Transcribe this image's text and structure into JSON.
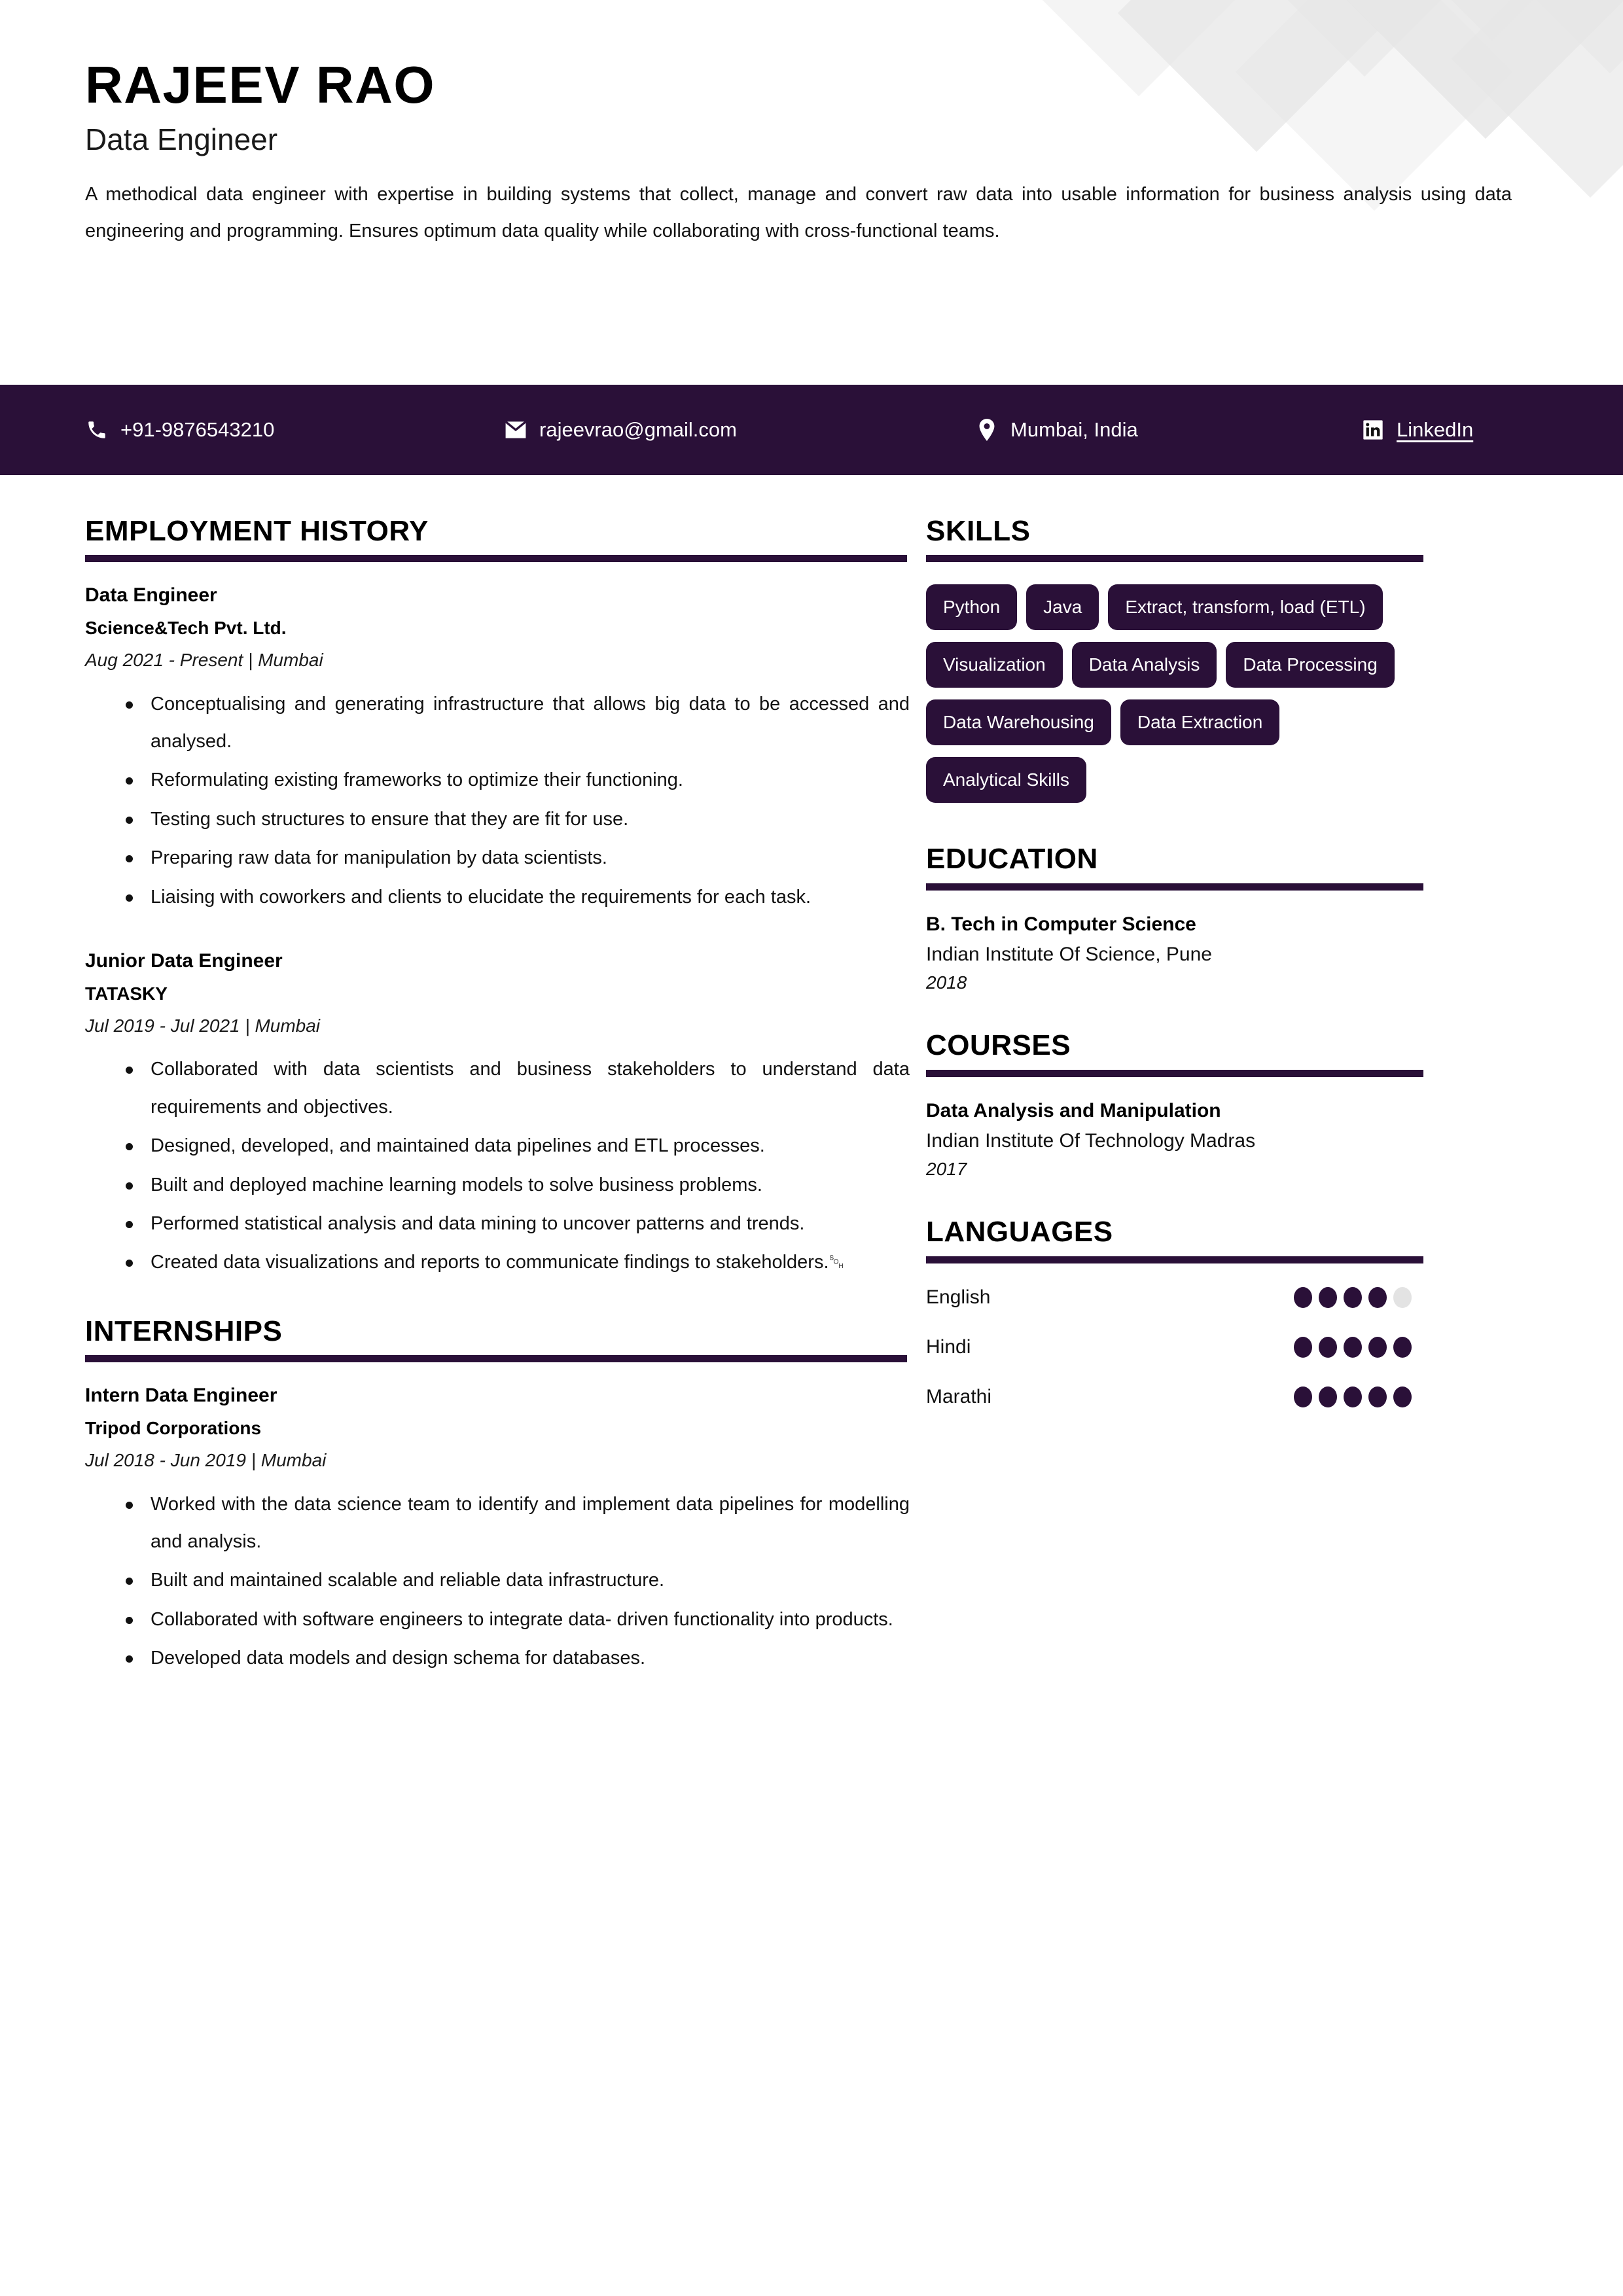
{
  "theme": {
    "accent": "#2a1038",
    "dot_filled": "#2a1038",
    "dot_empty": "#e3e3e3",
    "decoration": "#e6e6e6"
  },
  "header": {
    "name": "RAJEEV RAO",
    "role": "Data Engineer",
    "summary": "A methodical data engineer with expertise in building systems that collect, manage and convert raw data into usable information for business analysis using  data engineering and programming. Ensures optimum data quality while collaborating with cross-functional teams."
  },
  "contact": {
    "phone": {
      "icon": "phone-icon",
      "value": "+91-9876543210"
    },
    "email": {
      "icon": "envelope-icon",
      "value": "rajeevrao@gmail.com"
    },
    "location": {
      "icon": "map-pin-icon",
      "value": "Mumbai, India"
    },
    "linkedin": {
      "icon": "linkedin-icon",
      "value": "LinkedIn"
    }
  },
  "sections": {
    "employment_history": {
      "title": "EMPLOYMENT HISTORY",
      "jobs": [
        {
          "title": "Data Engineer",
          "company": "Science&Tech Pvt. Ltd.",
          "meta": "Aug 2021 - Present | Mumbai",
          "bullets": [
            "Conceptualising and generating infrastructure that allows big data to be accessed and analysed.",
            "Reformulating existing frameworks to optimize their functioning.",
            "Testing such structures to ensure that they are fit for use.",
            "Preparing raw data for manipulation by data scientists.",
            "Liaising with coworkers and clients to elucidate the requirements for each task."
          ]
        },
        {
          "title": "Junior Data Engineer",
          "company": "TATASKY",
          "meta": "Jul 2019 - Jul 2021 | Mumbai",
          "bullets": [
            "Collaborated with data scientists and business stakeholders to understand data requirements and objectives.",
            "Designed, developed, and maintained data pipelines and ETL processes.",
            "Built and deployed machine learning models to solve business problems.",
            "Performed statistical analysis and data mining to uncover patterns and trends.",
            "Created data visualizations and reports to communicate findings to stakeholders.␁"
          ]
        }
      ]
    },
    "internships": {
      "title": "INTERNSHIPS",
      "jobs": [
        {
          "title": "Intern Data Engineer",
          "company": "Tripod Corporations",
          "meta": "Jul 2018 - Jun 2019 | Mumbai",
          "bullets": [
            "Worked with the data science team to identify and implement data pipelines for modelling and analysis.",
            "Built and maintained scalable and reliable data infrastructure.",
            "Collaborated with software engineers to integrate data- driven functionality into products.",
            "Developed data models and design schema for databases."
          ]
        }
      ]
    },
    "skills": {
      "title": "SKILLS",
      "items": [
        "Python",
        "Java",
        "Extract, transform, load (ETL)",
        "Visualization",
        "Data Analysis",
        "Data Processing",
        "Data Warehousing",
        "Data Extraction",
        "Analytical Skills"
      ]
    },
    "education": {
      "title": "EDUCATION",
      "entries": [
        {
          "degree": "B. Tech in Computer Science",
          "institution": "Indian Institute Of Science, Pune",
          "year": "2018"
        }
      ]
    },
    "courses": {
      "title": "COURSES",
      "entries": [
        {
          "name": "Data Analysis and Manipulation",
          "institution": "Indian Institute Of Technology Madras",
          "year": "2017"
        }
      ]
    },
    "languages": {
      "title": "LANGUAGES",
      "max_level": 5,
      "items": [
        {
          "name": "English",
          "level": 4
        },
        {
          "name": "Hindi",
          "level": 5
        },
        {
          "name": "Marathi",
          "level": 5
        }
      ]
    }
  }
}
